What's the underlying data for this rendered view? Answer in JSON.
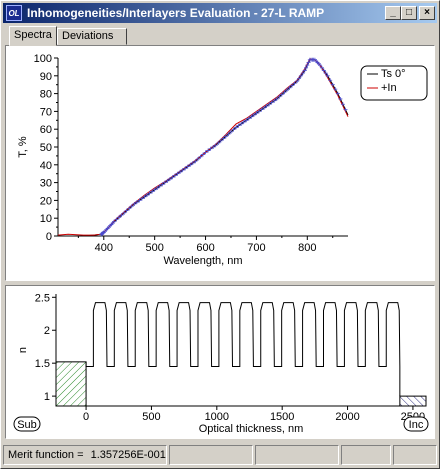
{
  "window": {
    "title": "Inhomogeneities/Interlayers Evaluation - 27-L RAMP",
    "icon_label": "OL",
    "minimize_glyph": "_",
    "maximize_glyph": "□",
    "close_glyph": "×"
  },
  "tabs": [
    {
      "label": "Spectra",
      "active": true
    },
    {
      "label": "Deviations",
      "active": false
    }
  ],
  "chart_data": [
    {
      "type": "line",
      "xlabel": "Wavelength, nm",
      "ylabel": "T, %",
      "xlim": [
        310,
        880
      ],
      "ylim": [
        0,
        100
      ],
      "x_ticks": [
        "400",
        "500",
        "600",
        "700",
        "800"
      ],
      "y_ticks": [
        "0",
        "10",
        "20",
        "30",
        "40",
        "50",
        "60",
        "70",
        "80",
        "90",
        "100"
      ],
      "legend": {
        "placement": "top-right"
      },
      "series": [
        {
          "name": "Ts 0°",
          "color": "#000000",
          "marker": "+",
          "x": [
            310,
            330,
            360,
            380,
            395,
            400,
            410,
            420,
            440,
            460,
            480,
            500,
            520,
            540,
            560,
            580,
            600,
            620,
            640,
            660,
            680,
            700,
            720,
            740,
            760,
            780,
            795,
            805,
            815,
            825,
            840,
            860,
            880
          ],
          "y": [
            0,
            0,
            0,
            0.5,
            1,
            2,
            5,
            8,
            13,
            18,
            22,
            26,
            30,
            34,
            38,
            42,
            47,
            51,
            56,
            61,
            65,
            69,
            73,
            77,
            82,
            87,
            93,
            99,
            99,
            96,
            90,
            80,
            68
          ]
        },
        {
          "name": "+In",
          "color": "#cc0000",
          "x": [
            310,
            330,
            360,
            380,
            395,
            400,
            410,
            420,
            440,
            460,
            480,
            500,
            520,
            540,
            560,
            580,
            600,
            620,
            640,
            660,
            680,
            700,
            720,
            740,
            760,
            780,
            795,
            805,
            815,
            825,
            840,
            860,
            880
          ],
          "y": [
            0.5,
            1,
            0.5,
            0.5,
            1,
            2,
            5,
            8.5,
            13.5,
            18.5,
            23,
            27,
            30.5,
            34.5,
            38.5,
            42.5,
            47,
            51.5,
            57,
            63,
            66,
            70,
            74,
            78,
            83,
            87.5,
            94,
            99.5,
            99,
            96,
            89,
            79,
            67
          ]
        }
      ]
    },
    {
      "type": "line",
      "xlabel": "Optical thickness, nm",
      "ylabel": "n",
      "xlim": [
        -230,
        2600
      ],
      "ylim": [
        0.85,
        2.55
      ],
      "x_ticks": [
        "0",
        "500",
        "1000",
        "1500",
        "2000",
        "2500"
      ],
      "y_ticks": [
        "1",
        "1.5",
        "2",
        "2.5"
      ],
      "substrate_label": "Sub",
      "incident_label": "Inc",
      "substrate_n": 1.52,
      "incident_n": 1.0,
      "layer_count": 15,
      "total_optical_thickness": 2400,
      "low_n": 1.45,
      "high_n_top": 2.42,
      "high_n_bottom": 2.3
    }
  ],
  "status": {
    "merit_label": "Merit function =",
    "merit_value": "1.357256E-001",
    "cells": [
      "",
      "",
      "",
      ""
    ]
  }
}
